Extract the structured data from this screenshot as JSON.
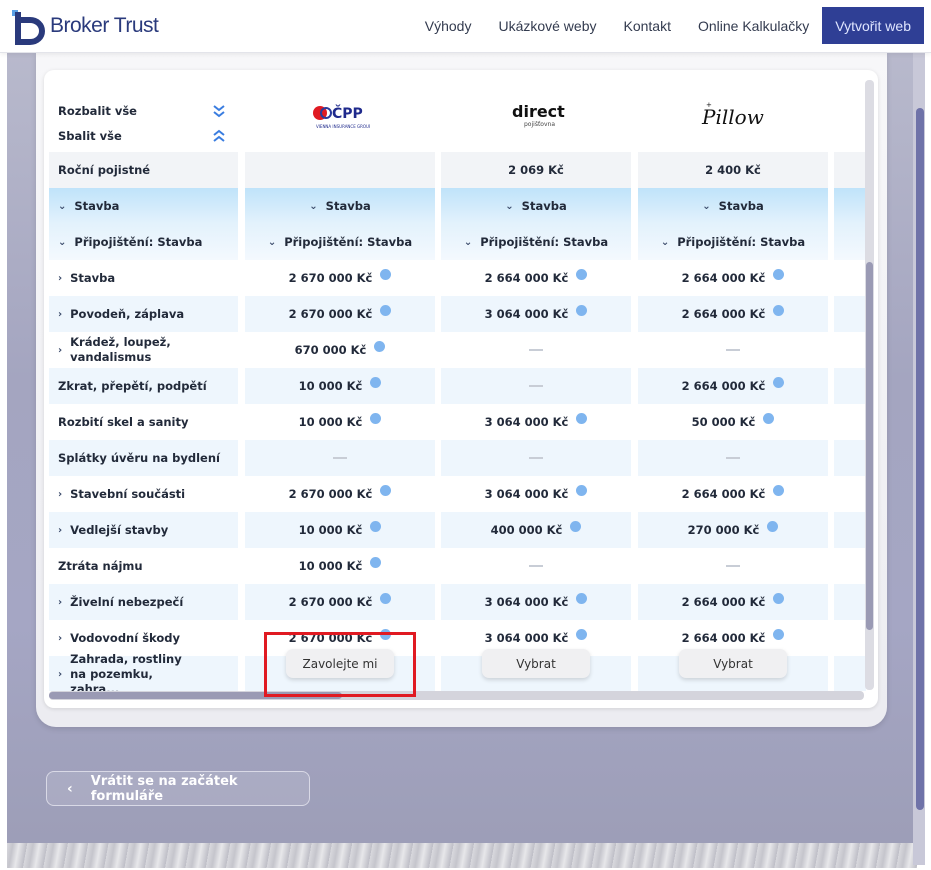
{
  "header": {
    "brand": "Broker Trust",
    "nav": [
      "Výhody",
      "Ukázkové weby",
      "Kontakt",
      "Online Kalkulačky"
    ],
    "cta": "Vytvořit web"
  },
  "table": {
    "expand_all": "Rozbalit vše",
    "collapse_all": "Sbalit vše",
    "annual_premium_label": "Roční pojistné",
    "section": "Stavba",
    "subsection": "Připojištění: Stavba",
    "rows": [
      "Stavba",
      "Povodeň, záplava",
      "Krádež, loupež, vandalismus",
      "Zkrat, přepětí, podpětí",
      "Rozbití skel a sanity",
      "Splátky úvěru na bydlení",
      "Stavební součásti",
      "Vedlejší stavby",
      "Ztráta nájmu",
      "Živelní nebezpečí",
      "Vodovodní škody",
      "Zahrada, rostliny na pozemku, zahra..."
    ],
    "providers": [
      {
        "name": "ČPP",
        "logo_sub": "VIENNA INSURANCE GROUP",
        "price": "",
        "values": [
          "2 670 000 Kč",
          "2 670 000 Kč",
          "670 000 Kč",
          "10 000 Kč",
          "10 000 Kč",
          "",
          "2 670 000 Kč",
          "10 000 Kč",
          "10 000 Kč",
          "2 670 000 Kč",
          "2 670 000 Kč"
        ],
        "button": "Zavolejte mi"
      },
      {
        "name": "direct",
        "logo_sub": "pojišťovna",
        "price": "2 069 Kč",
        "values": [
          "2 664 000 Kč",
          "3 064 000 Kč",
          "",
          "",
          "3 064 000 Kč",
          "",
          "3 064 000 Kč",
          "400 000 Kč",
          "",
          "3 064 000 Kč",
          "3 064 000 Kč"
        ],
        "button": "Vybrat"
      },
      {
        "name": "Pillow",
        "logo_sub": "",
        "price": "2 400 Kč",
        "values": [
          "2 664 000 Kč",
          "2 664 000 Kč",
          "",
          "2 664 000 Kč",
          "50 000 Kč",
          "",
          "2 664 000 Kč",
          "270 000 Kč",
          "",
          "2 664 000 Kč",
          "2 664 000 Kč"
        ],
        "button": "Vybrat"
      }
    ]
  },
  "back_button": "Vrátit se na začátek formuláře",
  "colors": {
    "brand": "#2a3a7c",
    "cta": "#2f3f95",
    "highlight": "#e01a22",
    "info": "#7fb5ef"
  }
}
